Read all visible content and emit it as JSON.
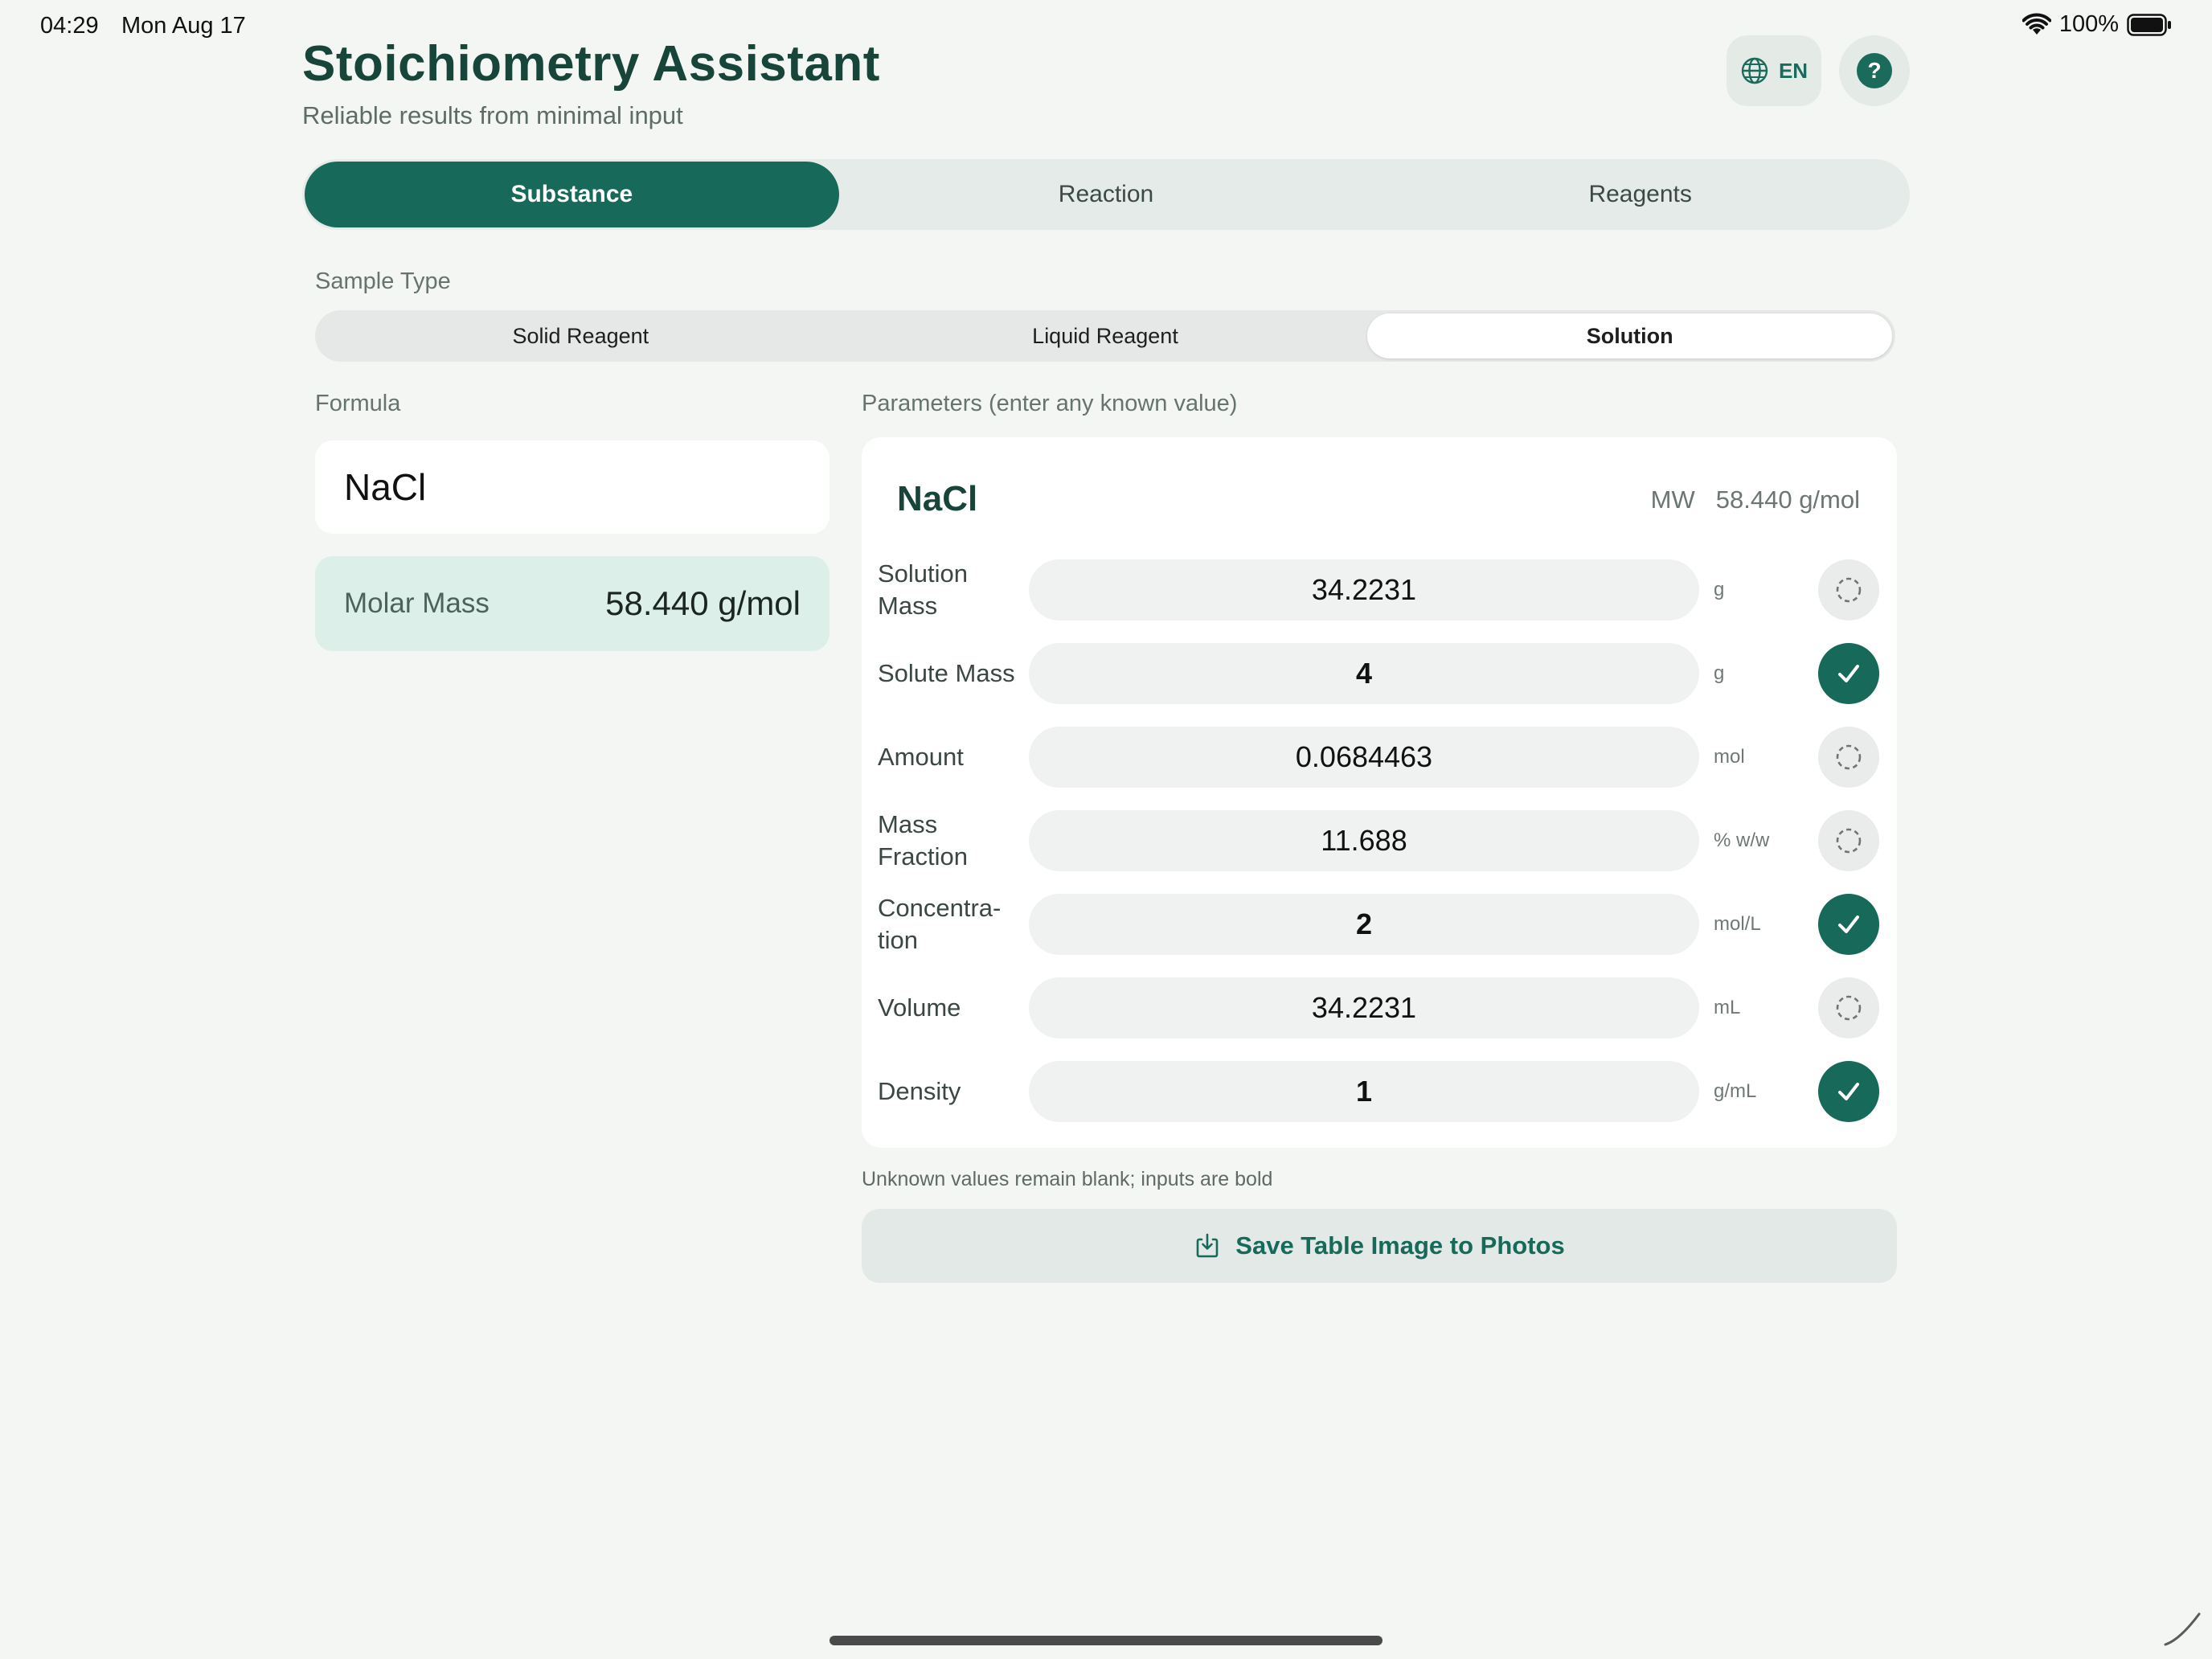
{
  "status_bar": {
    "time": "04:29",
    "date": "Mon Aug 17",
    "battery": "100%"
  },
  "header": {
    "title": "Stoichiometry Assistant",
    "subtitle": "Reliable results from minimal input",
    "language": "EN",
    "help_label": "?"
  },
  "tabs": [
    {
      "label": "Substance",
      "active": true
    },
    {
      "label": "Reaction",
      "active": false
    },
    {
      "label": "Reagents",
      "active": false
    }
  ],
  "sample_type": {
    "label": "Sample Type",
    "options": [
      "Solid Reagent",
      "Liquid Reagent",
      "Solution"
    ],
    "selected": "Solution"
  },
  "formula": {
    "label": "Formula",
    "value": "NaCl",
    "molar_mass_label": "Molar Mass",
    "molar_mass_value": "58.440 g/mol"
  },
  "parameters": {
    "label": "Parameters (enter any known value)",
    "formula": "NaCl",
    "mw_label": "MW",
    "mw_value": "58.440 g/mol",
    "rows": [
      {
        "label": "Solution\nMass",
        "value": "34.2231",
        "unit": "g",
        "is_input": false
      },
      {
        "label": "Solute Mass",
        "value": "4",
        "unit": "g",
        "is_input": true
      },
      {
        "label": "Amount",
        "value": "0.0684463",
        "unit": "mol",
        "is_input": false
      },
      {
        "label": "Mass\nFraction",
        "value": "11.688",
        "unit": "% w/w",
        "is_input": false
      },
      {
        "label": "Concentra-\ntion",
        "value": "2",
        "unit": "mol/L",
        "is_input": true
      },
      {
        "label": "Volume",
        "value": "34.2231",
        "unit": "mL",
        "is_input": false
      },
      {
        "label": "Density",
        "value": "1",
        "unit": "g/mL",
        "is_input": true
      }
    ],
    "hint": "Unknown values remain blank; inputs are bold"
  },
  "save_button": {
    "label": "Save Table Image to Photos"
  },
  "colors": {
    "accent": "#17695a",
    "title": "#17453a",
    "background": "#f3f6f3",
    "molar_card": "#dcefe9"
  },
  "icons": {
    "language": "globe-icon",
    "help": "question-icon",
    "save": "download-icon",
    "input_on": "checkmark-icon",
    "input_off": "dashed-circle-icon"
  }
}
